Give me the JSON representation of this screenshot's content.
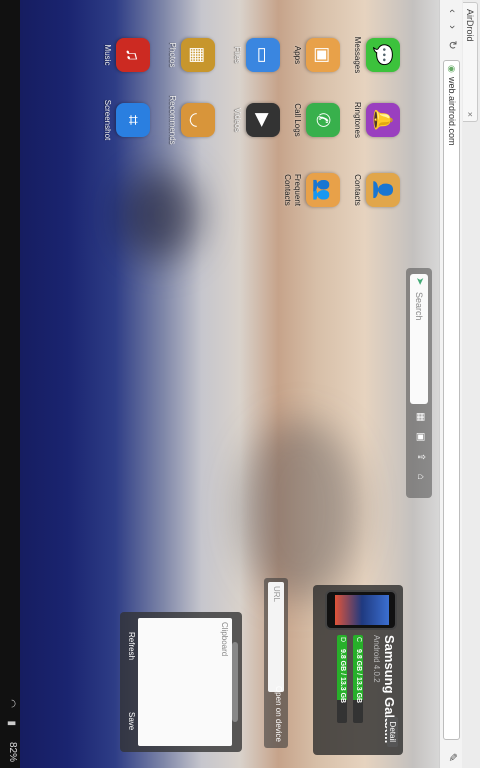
{
  "browser": {
    "tab_title": "AirDroid",
    "url": "web.airdroid.com"
  },
  "apps": [
    {
      "label": "Messages",
      "color": "#3cc23c",
      "glyph": "💬",
      "icon": "messages-icon"
    },
    {
      "label": "Ringtones",
      "color": "#9a3fbf",
      "glyph": "🔔",
      "icon": "ringtones-icon"
    },
    {
      "label": "Contacts",
      "color": "#e1a64a",
      "glyph": "👤",
      "icon": "contacts-icon"
    },
    {
      "label": "Apps",
      "color": "#e8a149",
      "glyph": "▣",
      "icon": "apps-icon"
    },
    {
      "label": "Call Logs",
      "color": "#38b04c",
      "glyph": "✆",
      "icon": "call-logs-icon"
    },
    {
      "label": "Frequent Contacts",
      "color": "#e8a149",
      "glyph": "👥",
      "icon": "frequent-contacts-icon"
    },
    {
      "label": "Files",
      "color": "#3a86e0",
      "glyph": "▭",
      "icon": "files-icon"
    },
    {
      "label": "Videos",
      "color": "#333333",
      "glyph": "▶",
      "icon": "videos-icon"
    },
    {
      "label": "Photos",
      "color": "#c7962d",
      "glyph": "▦",
      "icon": "photos-icon"
    },
    {
      "label": "Recommends",
      "color": "#d8953a",
      "glyph": "◡",
      "icon": "recommends-icon"
    },
    {
      "label": "Music",
      "color": "#cc2a22",
      "glyph": "♫",
      "icon": "music-icon"
    },
    {
      "label": "Screenshot",
      "color": "#2a7fe0",
      "glyph": "⌗",
      "icon": "screenshot-icon"
    }
  ],
  "toolbar": {
    "search_placeholder": "Search"
  },
  "device": {
    "name": "Samsung Galax...",
    "os": "Android 4.0.2",
    "storage": [
      {
        "key": "C",
        "text": "9.8 GB / 13.3 GB",
        "fill": 0.74
      },
      {
        "key": "D",
        "text": "9.8 GB / 13.3 GB",
        "fill": 0.74
      }
    ],
    "detail_label": "Detail"
  },
  "url_panel": {
    "placeholder": "URL",
    "open_label": "Open on device"
  },
  "clipboard": {
    "title": "Clipboard",
    "refresh_label": "Refresh",
    "save_label": "Save"
  },
  "status": {
    "battery": "82%"
  }
}
